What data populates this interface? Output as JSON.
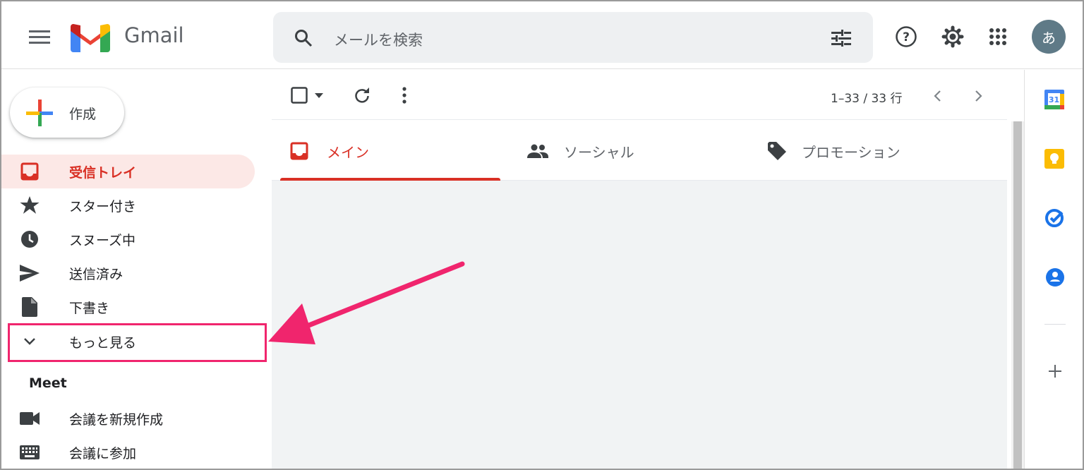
{
  "header": {
    "app_name": "Gmail",
    "search_placeholder": "メールを検索",
    "avatar_initial": "あ"
  },
  "sidebar": {
    "compose_label": "作成",
    "items": [
      {
        "label": "受信トレイ",
        "icon": "inbox-icon",
        "active": true
      },
      {
        "label": "スター付き",
        "icon": "star-icon"
      },
      {
        "label": "スヌーズ中",
        "icon": "clock-icon"
      },
      {
        "label": "送信済み",
        "icon": "send-icon"
      },
      {
        "label": "下書き",
        "icon": "draft-icon"
      },
      {
        "label": "もっと見る",
        "icon": "chevron-down-icon"
      }
    ],
    "meet": {
      "title": "Meet",
      "items": [
        {
          "label": "会議を新規作成",
          "icon": "video-icon"
        },
        {
          "label": "会議に参加",
          "icon": "keyboard-icon"
        }
      ]
    }
  },
  "toolbar": {
    "pager": "1–33 / 33 行"
  },
  "tabs": [
    {
      "label": "メイン",
      "icon": "inbox-icon",
      "active": true
    },
    {
      "label": "ソーシャル",
      "icon": "people-icon"
    },
    {
      "label": "プロモーション",
      "icon": "tag-icon"
    }
  ],
  "right_panel": {
    "calendar_day": "31"
  },
  "annotation": {
    "color": "#f0256d"
  },
  "colors": {
    "accent": "#d93025",
    "active_bg": "#fce8e6"
  }
}
